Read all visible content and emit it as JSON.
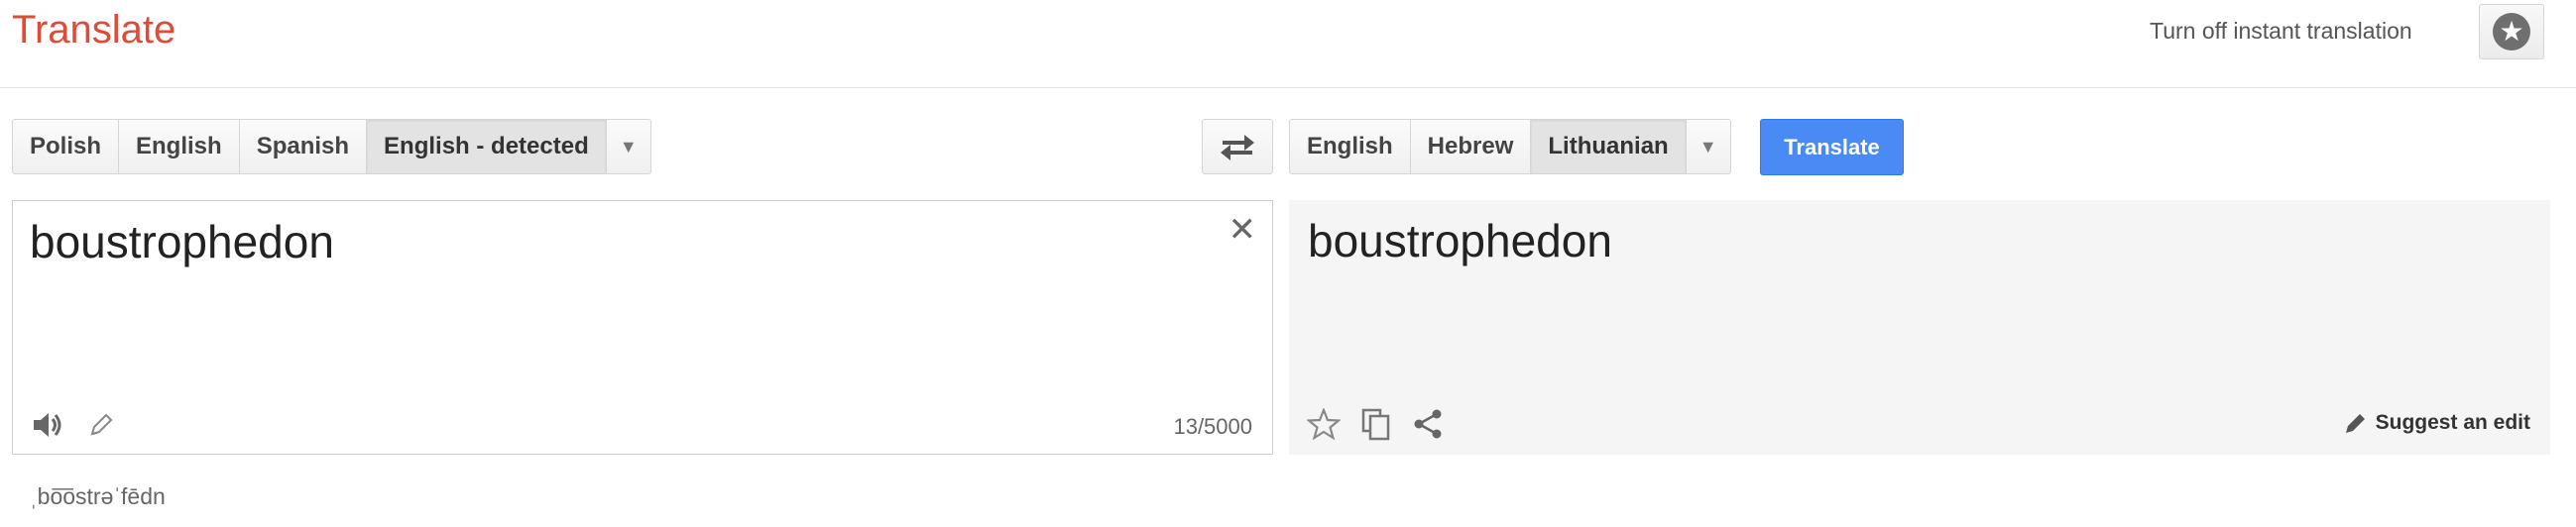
{
  "header": {
    "app_title": "Translate",
    "instant_link": "Turn off instant translation",
    "star_icon": "star-circle-icon"
  },
  "source_languages": {
    "items": [
      {
        "label": "Polish"
      },
      {
        "label": "English"
      },
      {
        "label": "Spanish"
      },
      {
        "label": "English - detected",
        "selected": true
      }
    ],
    "dropdown_icon": "caret-down-icon"
  },
  "swap_icon": "swap-arrows-icon",
  "target_languages": {
    "items": [
      {
        "label": "English"
      },
      {
        "label": "Hebrew"
      },
      {
        "label": "Lithuanian",
        "selected": true
      }
    ],
    "dropdown_icon": "caret-down-icon"
  },
  "translate_button": {
    "label": "Translate",
    "color": "#4a8af4"
  },
  "source": {
    "text": "boustrophedon",
    "char_count": "13/5000",
    "icons": [
      "speaker-icon",
      "pencil-icon",
      "close-icon"
    ]
  },
  "target": {
    "text": "boustrophedon",
    "suggest_label": "Suggest an edit",
    "icons": [
      "star-outline-icon",
      "copy-icon",
      "share-icon",
      "pencil-icon"
    ]
  },
  "phonetic": "ˌbo͞ostrəˈfēdn",
  "colors": {
    "title": "#dd4b39",
    "accent": "#4a8af4"
  }
}
